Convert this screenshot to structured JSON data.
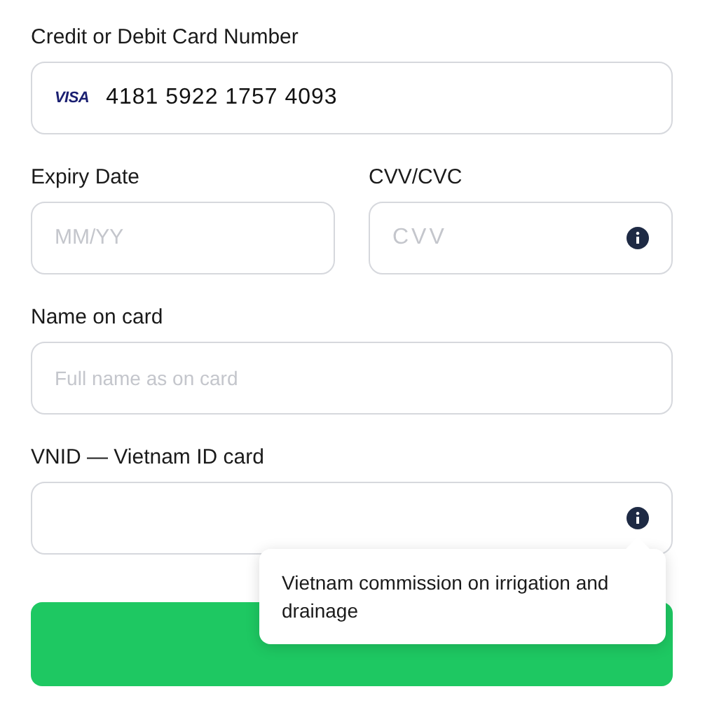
{
  "card_number": {
    "label": "Credit or Debit Card Number",
    "brand": "VISA",
    "value": "4181 5922 1757 4093"
  },
  "expiry": {
    "label": "Expiry Date",
    "placeholder": "MM/YY"
  },
  "cvv": {
    "label": "CVV/CVC",
    "placeholder": "CVV",
    "info": true
  },
  "name": {
    "label": "Name on card",
    "placeholder": "Full name as on card"
  },
  "vnid": {
    "label": "VNID — Vietnam ID card",
    "info": true,
    "tooltip": "Vietnam commission on irrigation and drainage"
  }
}
